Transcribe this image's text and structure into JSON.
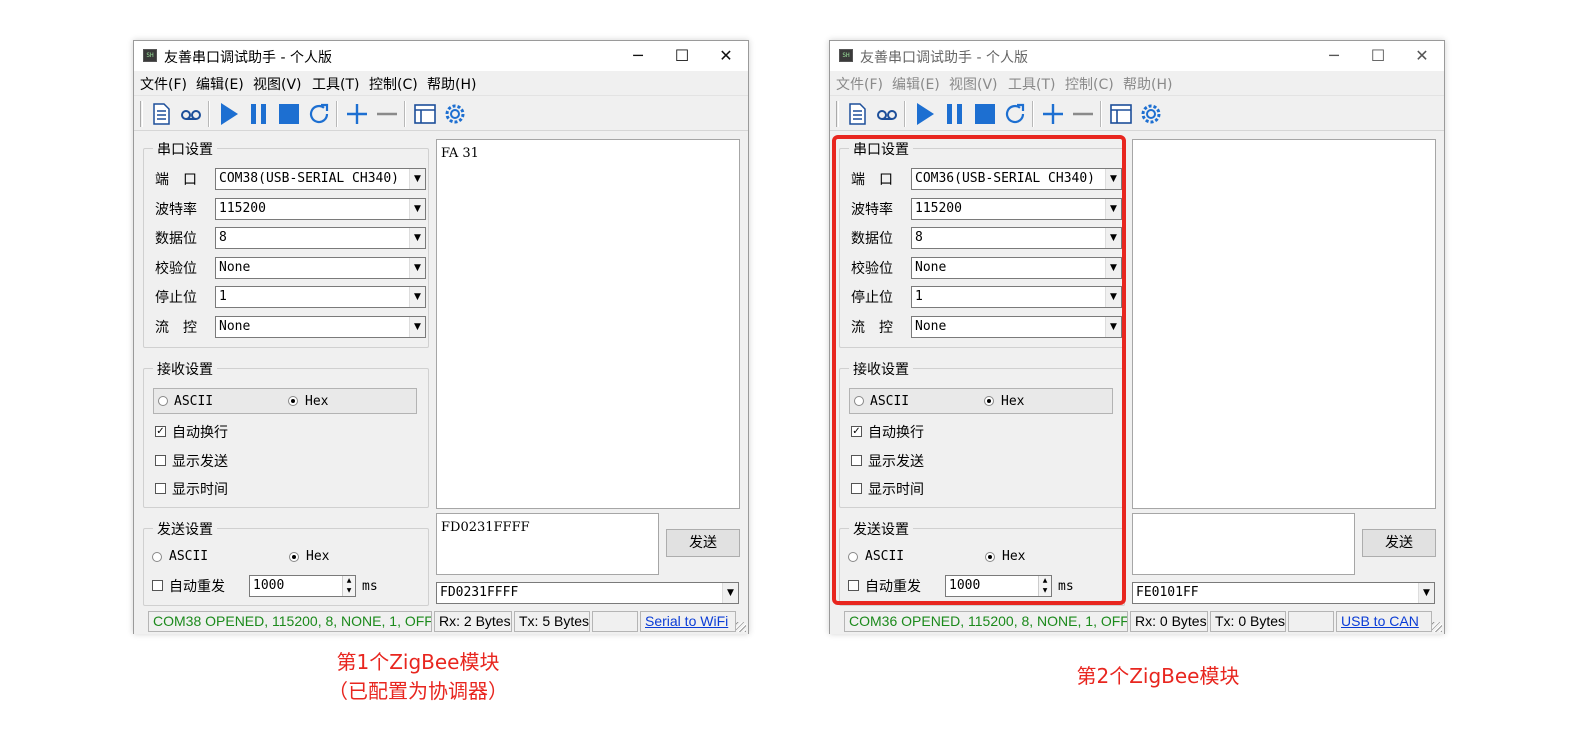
{
  "windows": [
    {
      "title": "友善串口调试助手 - 个人版",
      "menu": [
        "文件(F)",
        "编辑(E)",
        "视图(V)",
        "工具(T)",
        "控制(C)",
        "帮助(H)"
      ],
      "serial_group": "串口设置",
      "fields": [
        {
          "label": "端　口",
          "value": "COM38(USB-SERIAL CH340)"
        },
        {
          "label": "波特率",
          "value": "115200"
        },
        {
          "label": "数据位",
          "value": "8"
        },
        {
          "label": "校验位",
          "value": "None"
        },
        {
          "label": "停止位",
          "value": "1"
        },
        {
          "label": "流　控",
          "value": "None"
        }
      ],
      "recv_group": "接收设置",
      "recv_ascii": "ASCII",
      "recv_hex": "Hex",
      "recv_mode": "Hex",
      "auto_newline": "自动换行",
      "show_send": "显示发送",
      "show_time": "显示时间",
      "send_group": "发送设置",
      "send_ascii": "ASCII",
      "send_hex": "Hex",
      "send_mode": "Hex",
      "auto_resend": "自动重发",
      "interval": "1000",
      "interval_unit": "ms",
      "recv_text": "FA 31",
      "send_text": "FD0231FFFF",
      "send_button": "发送",
      "history_value": "FD0231FFFF",
      "status_conn": "COM38 OPENED, 115200, 8, NONE, 1, OFF",
      "status_rx": "Rx: 2 Bytes",
      "status_tx": "Tx: 5 Bytes",
      "status_link": "Serial to WiFi"
    },
    {
      "title": "友善串口调试助手 - 个人版",
      "menu": [
        "文件(F)",
        "编辑(E)",
        "视图(V)",
        "工具(T)",
        "控制(C)",
        "帮助(H)"
      ],
      "serial_group": "串口设置",
      "fields": [
        {
          "label": "端　口",
          "value": "COM36(USB-SERIAL CH340)"
        },
        {
          "label": "波特率",
          "value": "115200"
        },
        {
          "label": "数据位",
          "value": "8"
        },
        {
          "label": "校验位",
          "value": "None"
        },
        {
          "label": "停止位",
          "value": "1"
        },
        {
          "label": "流　控",
          "value": "None"
        }
      ],
      "recv_group": "接收设置",
      "recv_ascii": "ASCII",
      "recv_hex": "Hex",
      "recv_mode": "Hex",
      "auto_newline": "自动换行",
      "show_send": "显示发送",
      "show_time": "显示时间",
      "send_group": "发送设置",
      "send_ascii": "ASCII",
      "send_hex": "Hex",
      "send_mode": "Hex",
      "auto_resend": "自动重发",
      "interval": "1000",
      "interval_unit": "ms",
      "recv_text": "",
      "send_text": "",
      "send_button": "发送",
      "history_value": "FE0101FF",
      "status_conn": "COM36 OPENED, 115200, 8, NONE, 1, OFF",
      "status_rx": "Rx: 0 Bytes",
      "status_tx": "Tx: 0 Bytes",
      "status_link": "USB to CAN"
    }
  ],
  "captions": {
    "left_line1": "第1个ZigBee模块",
    "left_line2": "（已配置为协调器）",
    "right": "第2个ZigBee模块"
  },
  "colors": {
    "highlight": "#e8261f",
    "status_ok": "#1c8a1c",
    "link": "#0a3cd6",
    "play_blue": "#1d6fd1"
  },
  "toolbar_icons": [
    "document-icon",
    "record-icon",
    "play-icon",
    "pause-icon",
    "stop-icon",
    "refresh-icon",
    "add-icon",
    "remove-icon",
    "window-icon",
    "settings-icon"
  ]
}
